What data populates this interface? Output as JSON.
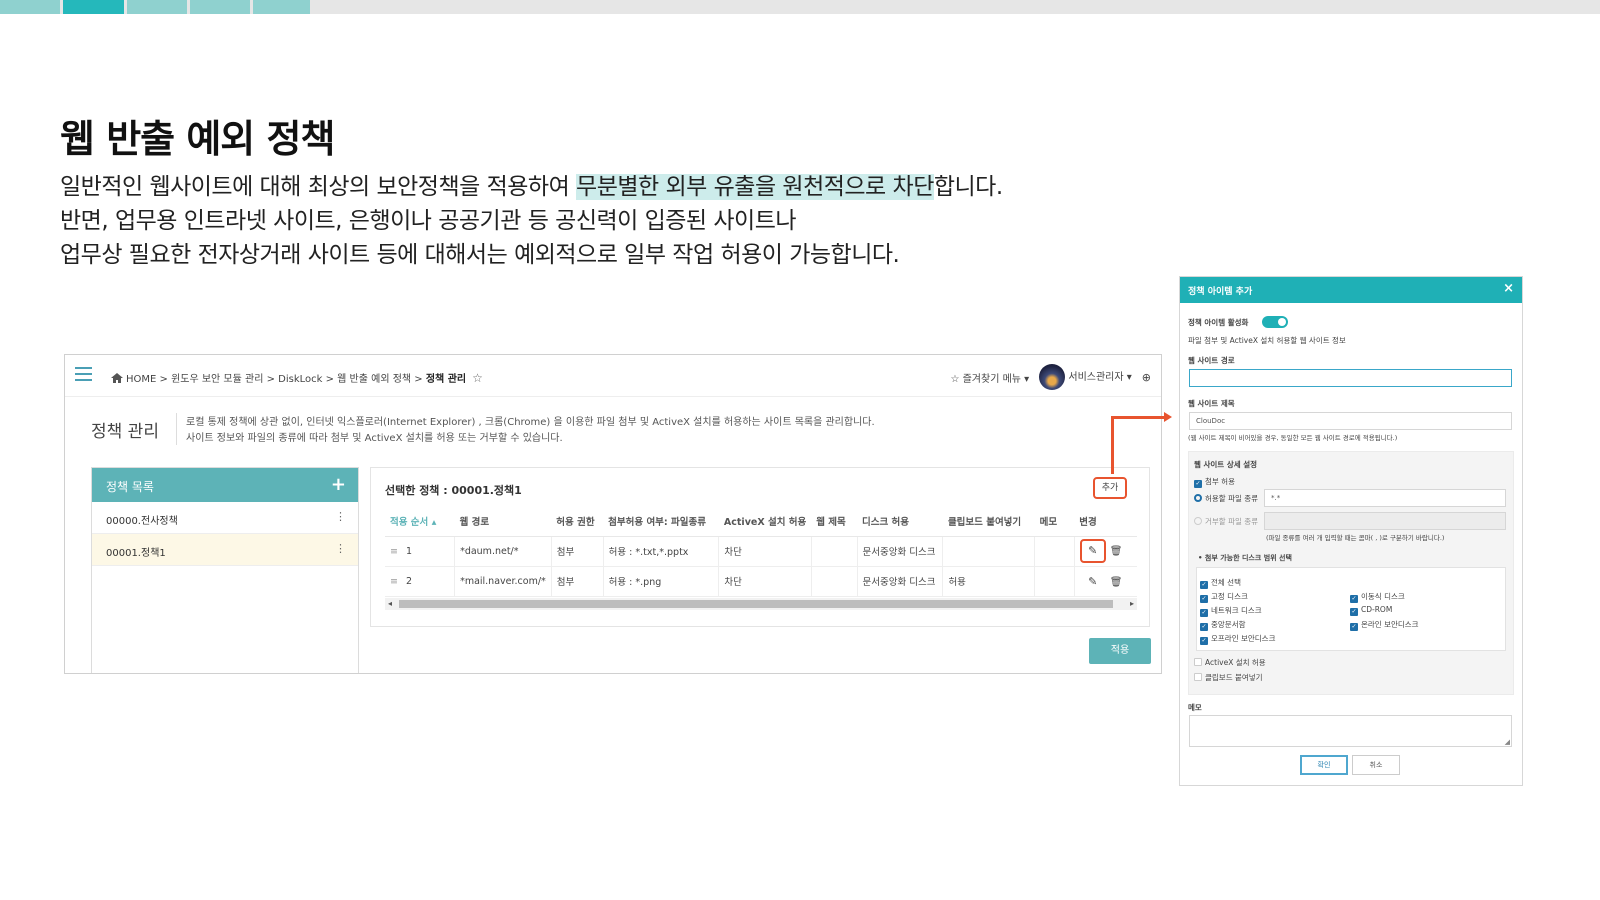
{
  "slide": {
    "title": "웹 반출 예외 정책",
    "desc_line1_pre": "일반적인 웹사이트에 대해 최상의 보안정책을 적용하여 ",
    "desc_line1_hl": "무분별한 외부 유출을 원천적으로 차단",
    "desc_line1_post": "합니다.",
    "desc_line2": "반면, 업무용 인트라넷 사이트, 은행이나 공공기관 등 공신력이 입증된 사이트나",
    "desc_line3": "업무상 필요한 전자상거래 사이트 등에 대해서는 예외적으로 일부 작업 허용이 가능합니다."
  },
  "colors": {
    "accent": "#1fb0b6",
    "panel_head": "#5db3b7",
    "highlight": "#e8542f"
  },
  "app": {
    "breadcrumb": {
      "home": "HOME",
      "path": " > 윈도우 보안 모듈 관리 > DiskLock > 웹 반출 예외 정책 > ",
      "current": "정책 관리"
    },
    "favorites": "즐겨찾기 메뉴 ▾",
    "user": "서비스관리자 ▾",
    "page_title": "정책 관리",
    "page_desc1": "로컬 통제 정책에 상관 없이, 인터넷 익스플로러(Internet Explorer) , 크롬(Chrome) 을 이용한 파일 첨부 및 ActiveX 설치를 허용하는 사이트 목록을 관리합니다.",
    "page_desc2": "사이트 정보와 파일의 종류에 따라 첨부 및 ActiveX 설치를 허용 또는 거부할 수 있습니다.",
    "policy_list": {
      "title": "정책 목록",
      "items": [
        "00000.전사정책",
        "00001.정책1"
      ]
    },
    "selected_policy": "선택한 정책 : 00001.정책1",
    "add_label": "추가",
    "table": {
      "headers": [
        "적용 순서 ▴",
        "웹 경로",
        "허용 권한",
        "첨부허용 여부: 파일종류",
        "ActiveX 설치 허용",
        "웹 제목",
        "디스크 허용",
        "클립보드 붙여넣기",
        "메모",
        "변경"
      ],
      "rows": [
        {
          "order": "1",
          "path": "*daum.net/*",
          "perm": "첨부",
          "attach": "허용 : *.txt,*.pptx",
          "activex": "차단",
          "title": "",
          "disk": "문서중앙화 디스크",
          "clip": "",
          "memo": ""
        },
        {
          "order": "2",
          "path": "*mail.naver.com/*",
          "perm": "첨부",
          "attach": "허용 : *.png",
          "activex": "차단",
          "title": "",
          "disk": "문서중앙화 디스크",
          "clip": "허용",
          "memo": ""
        }
      ]
    },
    "apply_label": "적용"
  },
  "dialog": {
    "title": "정책 아이템 추가",
    "activate_label": "정책 아이템 활성화",
    "info_label": "파일 첨부 및 ActiveX 설치 허용할 웹 사이트 정보",
    "path_label": "웹 사이트 경로",
    "path_value": "",
    "title_label": "웹 사이트 제목",
    "title_value": "ClouDoc",
    "title_note": "(웹 사이트 제목이 비어있을 경우, 동일한 모든 웹 사이트 경로에 적용됩니다.)",
    "detail_label": "웹 사이트 상세 설정",
    "attach_allow": "첨부 허용",
    "allow_types_label": "허용할 파일 종류",
    "allow_types_value": "*.*",
    "deny_types_label": "거부할 파일 종류",
    "types_note": "(파일 종류를 여러 개 입력할 때는 콤마( , )로 구분하기 바랍니다.)",
    "disk_scope_label": "• 첨부 가능한 디스크 범위 선택",
    "disks": {
      "all": "전체 선택",
      "fixed": "고정 디스크",
      "removable": "이동식 디스크",
      "network": "네트워크 디스크",
      "cdrom": "CD-ROM",
      "central": "중앙문서함",
      "online": "온라인 보안디스크",
      "offline": "오프라인 보안디스크"
    },
    "activex_allow": "ActiveX 설치 허용",
    "clipboard_paste": "클립보드 붙여넣기",
    "memo_label": "메모",
    "ok_label": "확인",
    "cancel_label": "취소"
  }
}
